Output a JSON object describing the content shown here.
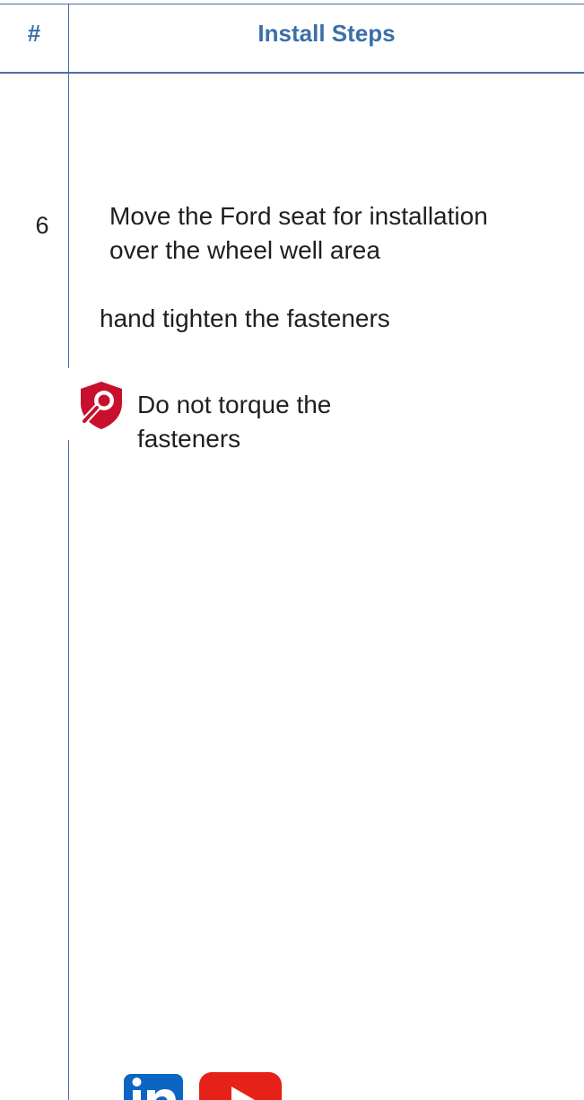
{
  "table": {
    "header": {
      "number_col": "#",
      "steps_col": "Install Steps"
    },
    "row": {
      "number": "6",
      "instruction_line1": "Move the Ford seat  for installation",
      "instruction_line2": "over the wheel well area",
      "subnote": "hand tighten the fasteners",
      "warning": {
        "icon": "inspect-shield-icon",
        "line1": "Do not torque the",
        "line2": "fasteners"
      }
    }
  },
  "footer": {
    "icons": [
      "linkedin-icon",
      "youtube-icon"
    ]
  },
  "colors": {
    "accent": "#3c6fa8",
    "warning": "#c8102e",
    "linkedin": "#0a66c2",
    "youtube": "#e62117"
  }
}
